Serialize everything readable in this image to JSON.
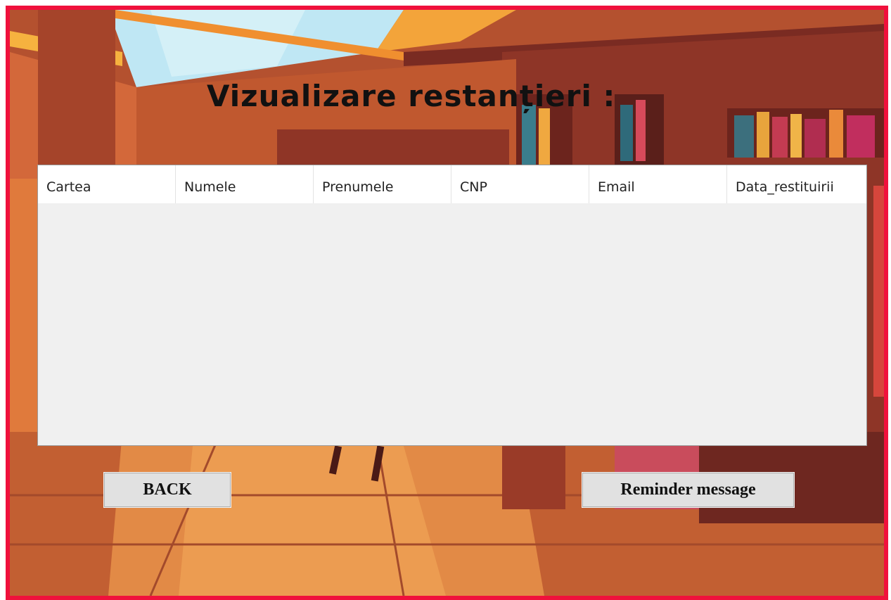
{
  "window": {
    "title": "Vizualizare restanțieri :"
  },
  "table": {
    "columns": [
      "Cartea",
      "Numele",
      "Prenumele",
      "CNP",
      "Email",
      "Data_restituirii"
    ],
    "rows": []
  },
  "buttons": {
    "back_label": "BACK",
    "reminder_label": "Reminder message"
  },
  "colors": {
    "frame_border": "#f0113c",
    "button_bg": "#e1e1e1",
    "table_bg": "#f0f0f0"
  }
}
